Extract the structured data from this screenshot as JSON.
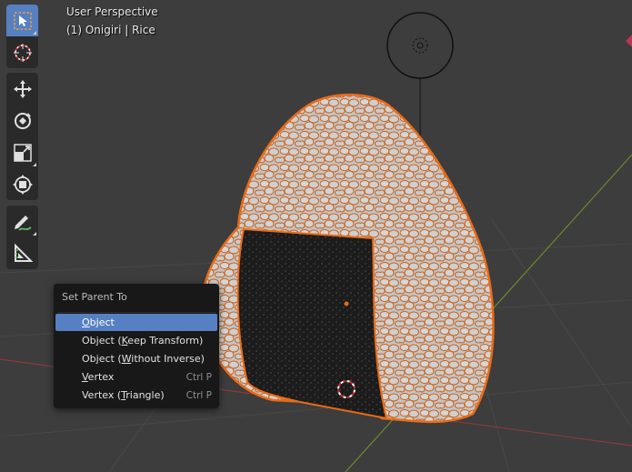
{
  "viewport": {
    "view_name": "User Perspective",
    "active_object": "(1) Onigiri | Rice"
  },
  "toolbar": {
    "groups": [
      [
        {
          "name": "select-box",
          "active": true
        },
        {
          "name": "cursor",
          "active": false
        }
      ],
      [
        {
          "name": "move",
          "active": false
        },
        {
          "name": "rotate",
          "active": false
        },
        {
          "name": "scale",
          "active": false
        },
        {
          "name": "transform",
          "active": false
        }
      ],
      [
        {
          "name": "annotate",
          "active": false
        },
        {
          "name": "measure",
          "active": false
        }
      ]
    ]
  },
  "menu": {
    "title": "Set Parent To",
    "items": [
      {
        "pre": "",
        "key": "O",
        "post": "bject",
        "shortcut": "",
        "highlighted": true
      },
      {
        "pre": "Object (",
        "key": "K",
        "post": "eep Transform)",
        "shortcut": "",
        "highlighted": false
      },
      {
        "pre": "Object (",
        "key": "W",
        "post": "ithout Inverse)",
        "shortcut": "",
        "highlighted": false
      },
      {
        "pre": "",
        "key": "V",
        "post": "ertex",
        "shortcut": "Ctrl P",
        "highlighted": false
      },
      {
        "pre": "Vertex (",
        "key": "T",
        "post": "riangle)",
        "shortcut": "Ctrl P",
        "highlighted": false
      }
    ]
  },
  "colors": {
    "background": "#3d3d3d",
    "accent": "#5680c2",
    "selection_outline": "#e86b18",
    "rice": "#c9c9c9",
    "nori": "#1e1e1e"
  }
}
